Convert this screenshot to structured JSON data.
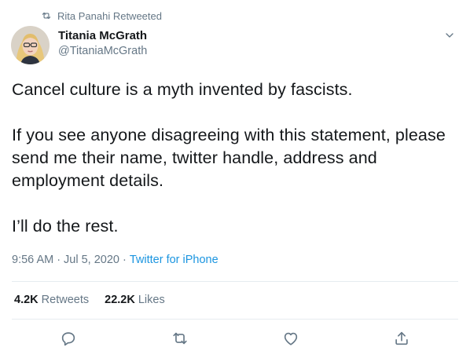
{
  "retweeted_by": "Rita Panahi Retweeted",
  "author": {
    "display_name": "Titania McGrath",
    "handle": "@TitaniaMcGrath"
  },
  "tweet": {
    "paragraphs": [
      "Cancel culture is a myth invented by fascists.",
      "If you see anyone disagreeing with this statement, please send me their name, twitter handle, address and employment details.",
      "I’ll do the rest."
    ]
  },
  "meta": {
    "time": "9:56 AM",
    "separator": "·",
    "date": "Jul 5, 2020",
    "source": "Twitter for iPhone"
  },
  "stats": {
    "retweets_count": "4.2K",
    "retweets_label": "Retweets",
    "likes_count": "22.2K",
    "likes_label": "Likes"
  },
  "icons": {
    "retweet_indicator": "retweet-icon",
    "caret": "chevron-down-icon",
    "reply": "reply-icon",
    "retweet": "retweet-icon",
    "like": "heart-icon",
    "share": "share-icon"
  },
  "colors": {
    "text": "#14171a",
    "secondary": "#657786",
    "link": "#1b95e0",
    "divider": "#e6ecf0"
  }
}
